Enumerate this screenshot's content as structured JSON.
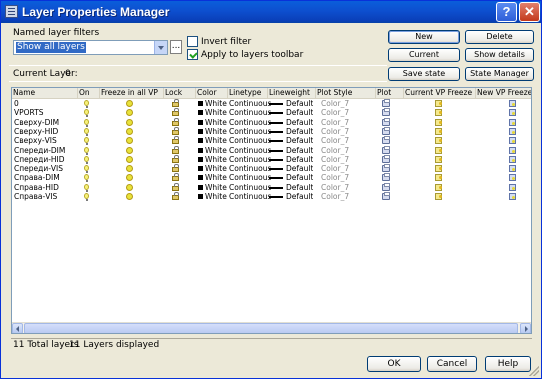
{
  "window": {
    "title": "Layer Properties Manager",
    "help_label": "?",
    "close_label": "✕"
  },
  "filters": {
    "group_label": "Named layer filters",
    "selected": "Show all layers",
    "dots_label": "...",
    "invert_filter_label": "Invert filter",
    "invert_filter_checked": false,
    "apply_toolbar_label": "Apply to layers toolbar",
    "apply_toolbar_checked": true
  },
  "buttons": {
    "new": "New",
    "delete": "Delete",
    "current": "Current",
    "show_details": "Show details",
    "save_state": "Save state",
    "state_manager": "State Manager",
    "ok": "OK",
    "cancel": "Cancel",
    "help": "Help"
  },
  "current_layer": {
    "label": "Current Layer:",
    "value": "0"
  },
  "table": {
    "columns": [
      "Name",
      "On",
      "Freeze in all VP",
      "Lock",
      "Color",
      "Linetype",
      "Lineweight",
      "Plot Style",
      "Plot",
      "Current VP Freeze",
      "New VP Freeze"
    ],
    "rows": [
      {
        "name": "0",
        "color": "White",
        "linetype": "Continuous",
        "lineweight": "Default",
        "plot_style": "Color_7"
      },
      {
        "name": "VPORTS",
        "color": "White",
        "linetype": "Continuous",
        "lineweight": "Default",
        "plot_style": "Color_7"
      },
      {
        "name": "Сверху-DIM",
        "color": "White",
        "linetype": "Continuous",
        "lineweight": "Default",
        "plot_style": "Color_7"
      },
      {
        "name": "Сверху-HID",
        "color": "White",
        "linetype": "Continuous",
        "lineweight": "Default",
        "plot_style": "Color_7"
      },
      {
        "name": "Сверху-VIS",
        "color": "White",
        "linetype": "Continuous",
        "lineweight": "Default",
        "plot_style": "Color_7"
      },
      {
        "name": "Спереди-DIM",
        "color": "White",
        "linetype": "Continuous",
        "lineweight": "Default",
        "plot_style": "Color_7"
      },
      {
        "name": "Спереди-HID",
        "color": "White",
        "linetype": "Continuous",
        "lineweight": "Default",
        "plot_style": "Color_7"
      },
      {
        "name": "Спереди-VIS",
        "color": "White",
        "linetype": "Continuous",
        "lineweight": "Default",
        "plot_style": "Color_7"
      },
      {
        "name": "Справа-DIM",
        "color": "White",
        "linetype": "Continuous",
        "lineweight": "Default",
        "plot_style": "Color_7"
      },
      {
        "name": "Справа-HID",
        "color": "White",
        "linetype": "Continuous",
        "lineweight": "Default",
        "plot_style": "Color_7"
      },
      {
        "name": "Справа-VIS",
        "color": "White",
        "linetype": "Continuous",
        "lineweight": "Default",
        "plot_style": "Color_7"
      }
    ]
  },
  "status": {
    "total": "11 Total layers",
    "displayed": "11 Layers displayed"
  },
  "icons": {
    "on": "lightbulb-icon",
    "freeze": "sun-icon",
    "lock": "padlock-icon",
    "plot": "printer-icon",
    "current_vp_freeze": "vp-freeze-icon",
    "new_vp_freeze": "new-vp-freeze-icon"
  },
  "colors": {
    "titlebar": "#0A5EDB",
    "selection": "#316AC5",
    "dialog": "#ECE9D8"
  }
}
